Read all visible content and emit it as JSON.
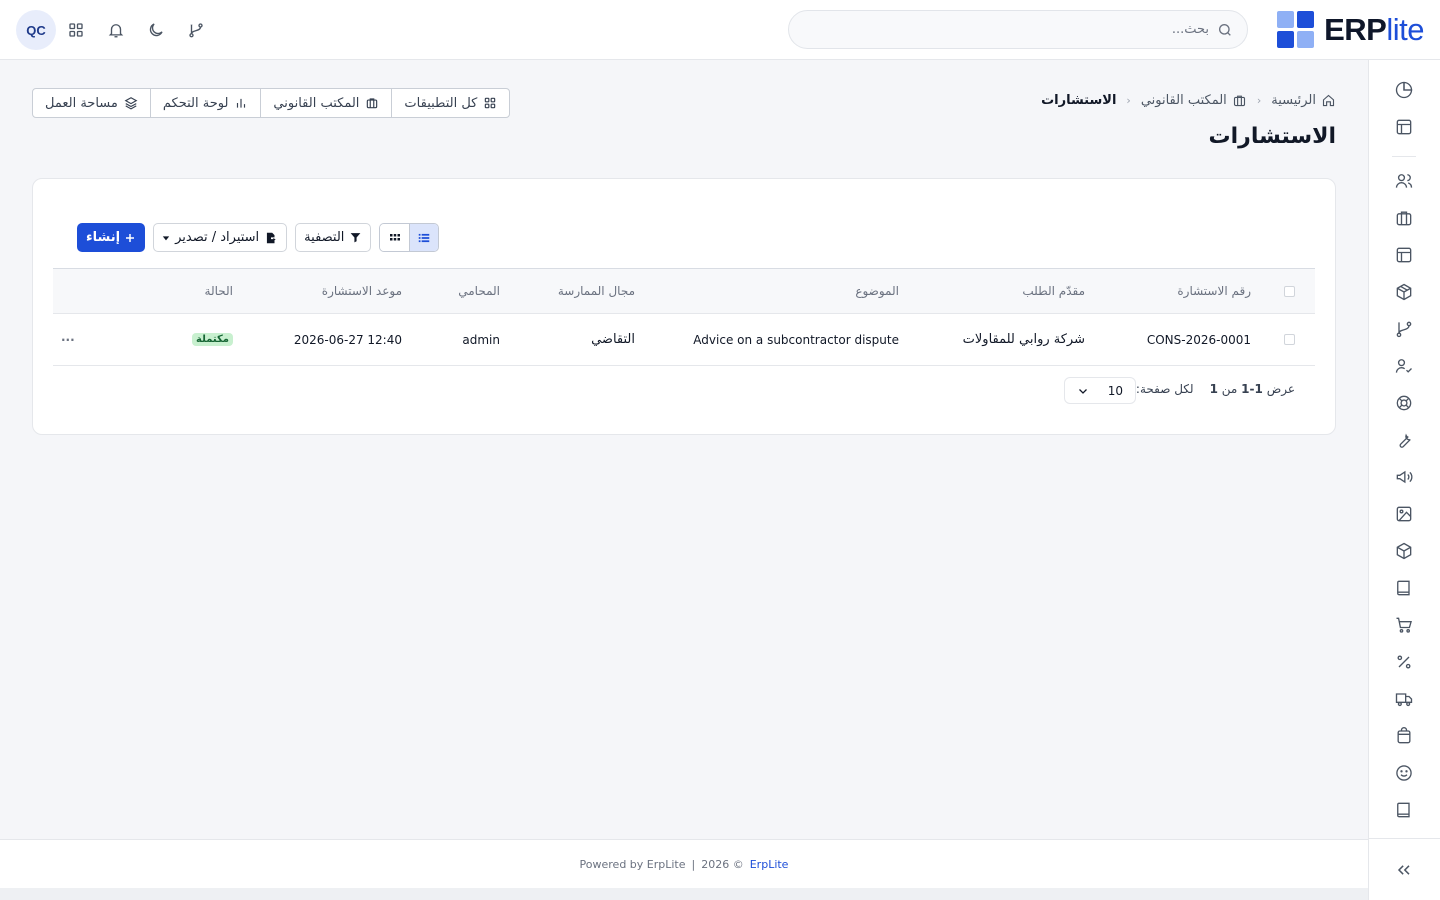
{
  "header": {
    "logo_main": "ERP",
    "logo_suffix": "lite",
    "search_placeholder": "بحث...",
    "avatar_initials": "QC"
  },
  "breadcrumb": {
    "home": "الرئيسية",
    "parent": "المكتب القانوني",
    "current": "الاستشارات"
  },
  "page": {
    "title": "الاستشارات"
  },
  "quicknav": {
    "all_apps": "كل التطبيقات",
    "legal_office": "المكتب القانوني",
    "dashboard": "لوحة التحكم",
    "workspace": "مساحة العمل"
  },
  "toolbar": {
    "create": "إنشاء",
    "import_export": "استيراد / تصدير",
    "filter": "التصفية"
  },
  "table": {
    "columns": [
      "رقم الاستشارة",
      "مقدّم الطلب",
      "الموضوع",
      "مجال الممارسة",
      "المحامي",
      "موعد الاستشارة",
      "الحالة"
    ],
    "rows": [
      {
        "number": "CONS-2026-0001",
        "requester": "شركة روابي للمقاولات",
        "subject": "Advice on a subcontractor dispute",
        "practice_area": "التقاضي",
        "lawyer": "admin",
        "datetime": "2026-06-27 12:40",
        "status": "مكتملة",
        "actions": "···"
      }
    ]
  },
  "pagination": {
    "showing_prefix": "عرض",
    "range": "1-1",
    "of_word": "من",
    "total": "1",
    "per_page_label": "لكل صفحة:",
    "per_page_value": "10"
  },
  "footer": {
    "powered": "Powered by ErpLite",
    "divider": "|",
    "copyright": "2026 ©",
    "brand": "ErpLite"
  },
  "colors": {
    "primary": "#1d4ed8",
    "logo_light": "#8fb0f5",
    "logo_dark": "#1d4ed8",
    "badge_bg": "#c8f0cf",
    "badge_fg": "#166534"
  }
}
